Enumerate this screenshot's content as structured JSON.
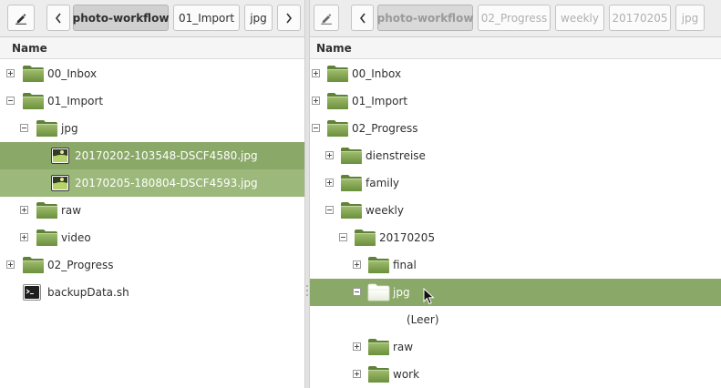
{
  "colors": {
    "selection": "#8aa867",
    "selection_secondary": "#9cb87a",
    "folder": "#7ea04f"
  },
  "left_pane": {
    "toolbar": {
      "edit_icon": "pencil-icon",
      "back_icon": "chevron-left-icon",
      "path": [
        "photo-workflow",
        "01_Import",
        "jpg"
      ],
      "forward_icon": "chevron-right-icon"
    },
    "column_header": "Name",
    "items": [
      {
        "label": "00_Inbox",
        "type": "folder",
        "expander": "plus"
      },
      {
        "label": "01_Import",
        "type": "folder",
        "expander": "minus"
      },
      {
        "label": "jpg",
        "type": "folder",
        "expander": "minus"
      },
      {
        "label": "20170202-103548-DSCF4580.jpg",
        "type": "image",
        "selected": true
      },
      {
        "label": "20170205-180804-DSCF4593.jpg",
        "type": "image",
        "selected": true
      },
      {
        "label": "raw",
        "type": "folder",
        "expander": "plus"
      },
      {
        "label": "video",
        "type": "folder",
        "expander": "plus"
      },
      {
        "label": "02_Progress",
        "type": "folder",
        "expander": "plus"
      },
      {
        "label": "backupData.sh",
        "type": "script"
      }
    ]
  },
  "right_pane": {
    "toolbar": {
      "edit_icon": "pencil-icon",
      "back_icon": "chevron-left-icon",
      "path": [
        "photo-workflow",
        "02_Progress",
        "weekly",
        "20170205",
        "jpg"
      ]
    },
    "column_header": "Name",
    "items": [
      {
        "label": "00_Inbox",
        "type": "folder",
        "expander": "plus"
      },
      {
        "label": "01_Import",
        "type": "folder",
        "expander": "plus"
      },
      {
        "label": "02_Progress",
        "type": "folder",
        "expander": "minus"
      },
      {
        "label": "dienstreise",
        "type": "folder",
        "expander": "plus"
      },
      {
        "label": "family",
        "type": "folder",
        "expander": "plus"
      },
      {
        "label": "weekly",
        "type": "folder",
        "expander": "minus"
      },
      {
        "label": "20170205",
        "type": "folder",
        "expander": "minus"
      },
      {
        "label": "final",
        "type": "folder",
        "expander": "plus"
      },
      {
        "label": "jpg",
        "type": "folder",
        "expander": "minus",
        "selected": true,
        "open": true
      },
      {
        "label": "(Leer)",
        "type": "placeholder"
      },
      {
        "label": "raw",
        "type": "folder",
        "expander": "plus"
      },
      {
        "label": "work",
        "type": "folder",
        "expander": "plus"
      }
    ]
  }
}
